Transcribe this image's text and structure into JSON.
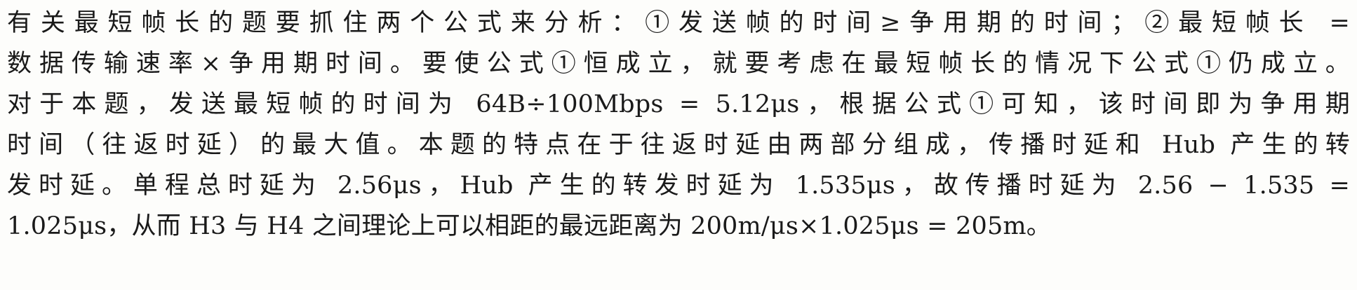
{
  "paragraph": {
    "lines": [
      "有关最短帧长的题要抓住两个公式来分析：①发送帧的时间≥争用期的时间；②最短帧长 =",
      "数据传输速率×争用期时间。要使公式①恒成立，就要考虑在最短帧长的情况下公式①仍成立。",
      "对于本题，发送最短帧的时间为 64B÷100Mbps = 5.12μs，根据公式①可知，该时间即为争用期",
      "时间（往返时延）的最大值。本题的特点在于往返时延由两部分组成，传播时延和 Hub 产生的转",
      "发时延。单程总时延为 2.56μs，Hub 产生的转发时延为 1.535μs，故传播时延为 2.56 − 1.535 =",
      "1.025μs，从而 H3 与 H4 之间理论上可以相距的最远距离为 200m/μs×1.025μs = 205m。"
    ]
  }
}
